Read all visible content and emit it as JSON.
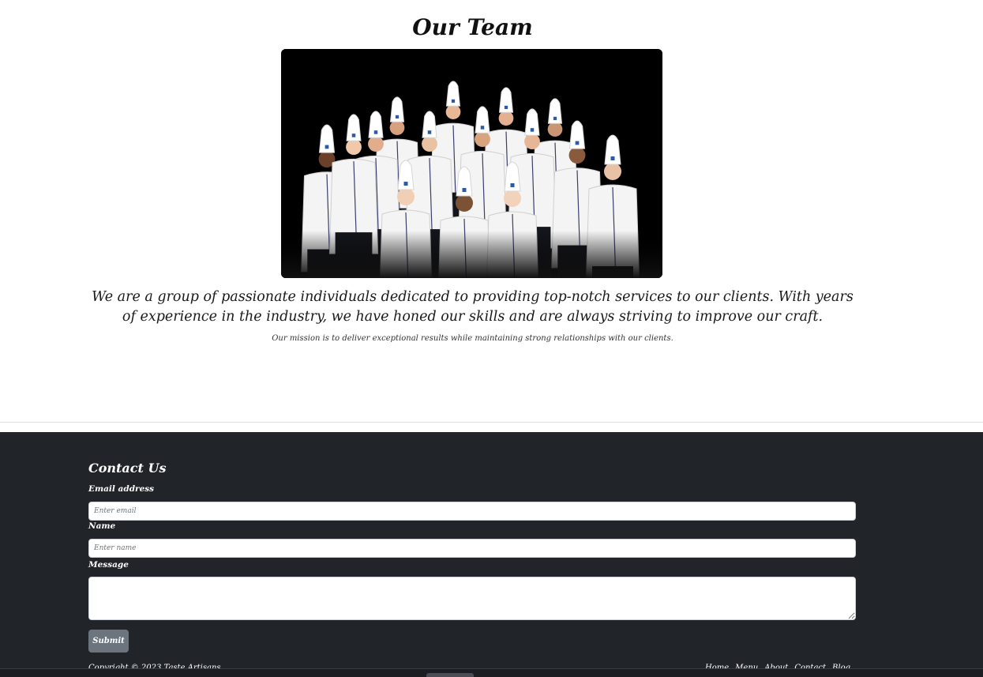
{
  "team": {
    "title": "Our Team",
    "photo_alt": "Group photo of chefs",
    "description": "We are a group of passionate individuals dedicated to providing top-notch services to our clients. With years of experience in the industry, we have honed our skills and are always striving to improve our craft.",
    "mission": "Our mission is to deliver exceptional results while maintaining strong relationships with our clients."
  },
  "contact": {
    "title": "Contact Us",
    "email_label": "Email address",
    "email_placeholder": "Enter email",
    "name_label": "Name",
    "name_placeholder": "Enter name",
    "message_label": "Message",
    "submit_label": "Submit"
  },
  "footer": {
    "copyright": "Copyright © 2023 Taste Artisans",
    "links": [
      "Home",
      "Menu",
      "About",
      "Contact",
      "Blog"
    ]
  },
  "colors": {
    "footer_bg": "#212529",
    "button_bg": "#6c757d"
  }
}
